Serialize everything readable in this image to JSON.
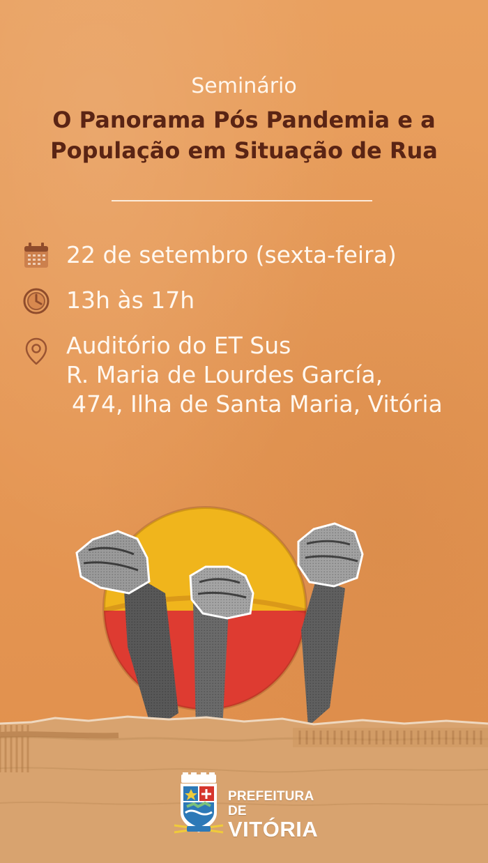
{
  "header": {
    "eyebrow": "Seminário",
    "title_line_1": "O Panorama Pós Pandemia e a",
    "title_line_2": "População em Situação de Rua"
  },
  "details": {
    "date": "22 de setembro (sexta-feira)",
    "time": "13h às 17h",
    "location_line_1": "Auditório do ET Sus",
    "location_line_2": "R. Maria de Lourdes García,",
    "location_line_3": "474, Ilha de Santa Maria, Vitória"
  },
  "brand": {
    "line_1": "PREFEITURA DE",
    "line_2": "VITÓRIA"
  },
  "icons": {
    "date": "calendar-icon",
    "time": "clock-icon",
    "location": "map-pin-icon"
  },
  "colors": {
    "background": "#e79a58",
    "title": "#5a2414",
    "text": "#fff8f0",
    "sun_yellow": "#f0b51c",
    "sun_red": "#de3b31",
    "cardboard": "#d8a36f"
  }
}
